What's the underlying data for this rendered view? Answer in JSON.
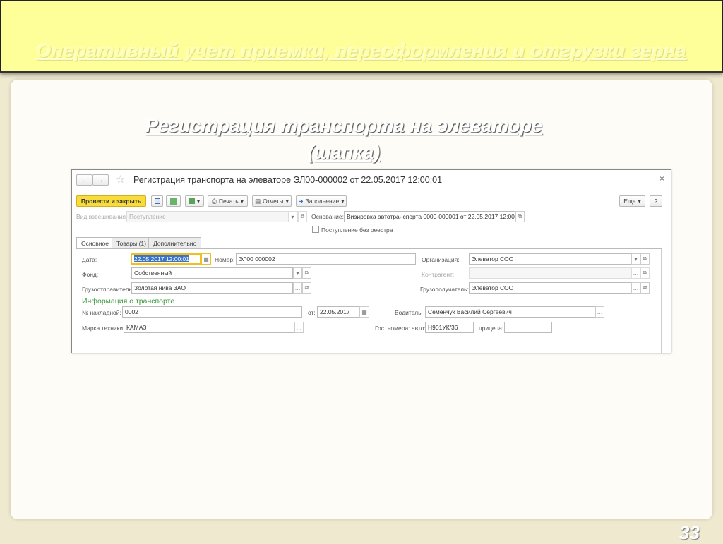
{
  "slide": {
    "banner_title": "Оперативный учет приемки, переоформления и отгрузки зерна",
    "heading_line1": "Регистрация транспорта на элеваторе",
    "heading_line2": "(шапка)",
    "page_number": "33"
  },
  "window": {
    "title": "Регистрация транспорта на элеваторе ЭЛ00-000002 от 22.05.2017 12:00:01",
    "close": "×",
    "back": "←",
    "forward": "→",
    "star": "☆"
  },
  "toolbar": {
    "post_close": "Провести и закрыть",
    "print": "Печать",
    "reports": "Отчеты",
    "fill": "Заполнение",
    "more": "Еще",
    "help": "?"
  },
  "header": {
    "weigh_type_label": "Вид взвешивания:",
    "weigh_type_value": "Поступление",
    "basis_label": "Основание:",
    "basis_value": "Визировка автотранспорта 0000-000001 от 22.05.2017 12:00:00",
    "no_registry_label": "Поступление без реестра",
    "no_registry_checked": false
  },
  "tabs": [
    {
      "label": "Основное",
      "active": true
    },
    {
      "label": "Товары (1)",
      "active": false
    },
    {
      "label": "Дополнительно",
      "active": false
    }
  ],
  "main": {
    "date_label": "Дата:",
    "date_value": "22.05.2017 12:00:01",
    "number_label": "Номер:",
    "number_value": "ЭЛ00 000002",
    "org_label": "Организация:",
    "org_value": "Элеватор СОО",
    "fund_label": "Фонд:",
    "fund_value": "Собственный",
    "counterparty_label": "Контрагент:",
    "counterparty_value": "",
    "shipper_label": "Грузоотправитель:",
    "shipper_value": "Золотая нива ЗАО",
    "consignee_label": "Грузополучатель:",
    "consignee_value": "Элеватор СОО",
    "transport_section": "Информация о транспорте",
    "waybill_label": "№ накладной:",
    "waybill_value": "0002",
    "from_label": "от:",
    "waybill_date": "22.05.2017",
    "driver_label": "Водитель:",
    "driver_value": "Семенчук Василий Сергеевич",
    "vehicle_label": "Марка техники:",
    "vehicle_value": "КАМАЗ",
    "plate_label": "Гос. номера: авто:",
    "plate_value": "Н901УК/36",
    "trailer_label": "прицепа:",
    "trailer_value": ""
  },
  "colors": {
    "accent_button": "#f7dc3c",
    "section_green": "#3a9a3a",
    "banner": "#ffff99"
  }
}
